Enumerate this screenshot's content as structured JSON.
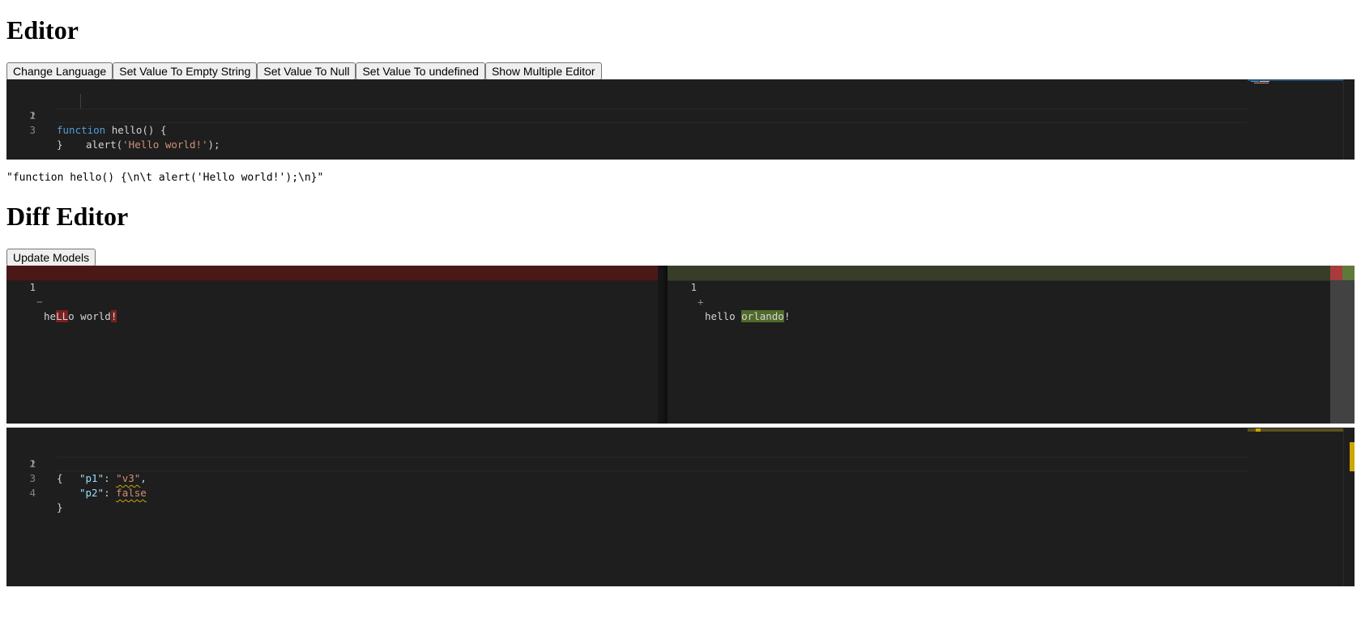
{
  "editor_section": {
    "heading": "Editor",
    "buttons": {
      "change_language": "Change Language",
      "set_empty": "Set Value To Empty String",
      "set_null": "Set Value To Null",
      "set_undefined": "Set Value To undefined",
      "show_multiple": "Show Multiple Editor"
    },
    "code": {
      "line_numbers": [
        "1",
        "2",
        "3"
      ],
      "line1_keyword": "function",
      "line1_rest": " hello() {",
      "line2_call": "alert(",
      "line2_string": "'Hello world!'",
      "line2_end": ");",
      "line3": "}"
    },
    "value_output": "\"function hello() {\\n\\t alert('Hello world!');\\n}\""
  },
  "diff_section": {
    "heading": "Diff Editor",
    "update_button": "Update Models",
    "original": {
      "line_number": "1",
      "marker": "−",
      "seg1": "he",
      "seg2_deleted": "LL",
      "seg3": "o world",
      "seg4_deleted": "!",
      "seg5": ""
    },
    "modified": {
      "line_number": "1",
      "marker": "+",
      "seg1": "hello ",
      "seg2_inserted": "orlando",
      "seg3": "!"
    }
  },
  "json_editor": {
    "line_numbers": [
      "1",
      "2",
      "3",
      "4"
    ],
    "line1": "{",
    "p1_key": "\"p1\"",
    "p1_value": "\"v3\"",
    "p2_key": "\"p2\"",
    "p2_value": "false",
    "colon": ": ",
    "comma": ",",
    "line4": "}"
  },
  "colors": {
    "editor_bg": "#1e1e1e",
    "keyword": "#569cd6",
    "string": "#ce9178",
    "json_key": "#9cdcfe",
    "warning": "#cca700",
    "diff_removed": "#4b1818",
    "diff_inserted": "#373d29"
  }
}
